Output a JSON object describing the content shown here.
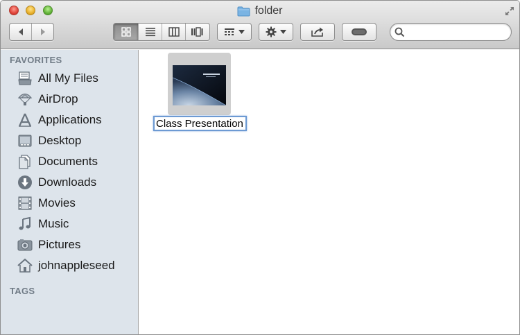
{
  "window": {
    "title": "folder"
  },
  "toolbar": {
    "view_modes": [
      "icon-view",
      "list-view",
      "column-view",
      "coverflow-view"
    ],
    "selected_view": "icon-view"
  },
  "search": {
    "value": "",
    "placeholder": ""
  },
  "sidebar": {
    "favorites_header": "FAVORITES",
    "items": [
      {
        "label": "All My Files",
        "icon": "all-files-icon"
      },
      {
        "label": "AirDrop",
        "icon": "airdrop-icon"
      },
      {
        "label": "Applications",
        "icon": "applications-icon"
      },
      {
        "label": "Desktop",
        "icon": "desktop-icon"
      },
      {
        "label": "Documents",
        "icon": "documents-icon"
      },
      {
        "label": "Downloads",
        "icon": "downloads-icon"
      },
      {
        "label": "Movies",
        "icon": "movies-icon"
      },
      {
        "label": "Music",
        "icon": "music-icon"
      },
      {
        "label": "Pictures",
        "icon": "pictures-icon"
      },
      {
        "label": "johnappleseed",
        "icon": "home-icon"
      }
    ],
    "tags_header": "TAGS"
  },
  "content": {
    "files": [
      {
        "name": "Class Presentation",
        "editing": true
      }
    ]
  },
  "colors": {
    "sidebar_bg": "#dde4eb",
    "section_header": "#707b86",
    "selection_ring": "#6d9ad3",
    "folder_icon": "#7bb4e3"
  }
}
